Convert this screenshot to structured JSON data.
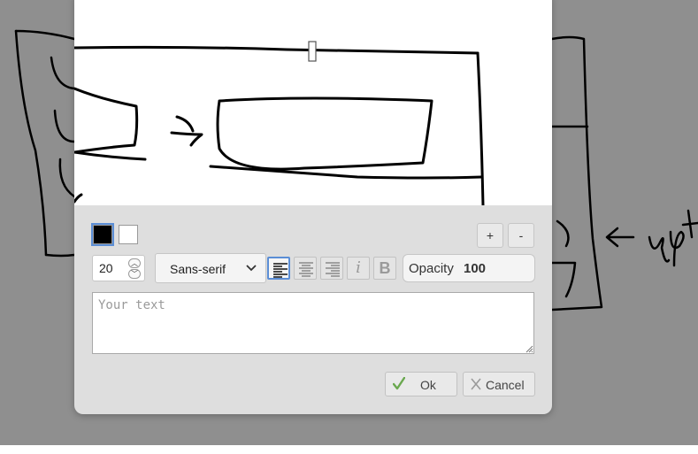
{
  "colors": {
    "accent": "#5b8ed6",
    "ok_check": "#6aa84f",
    "foreground": "#000000",
    "background": "#ffffff"
  },
  "background_sketch": {
    "annotation_text": "op"
  },
  "toolbar": {
    "zoom_in_label": "+",
    "zoom_out_label": "-",
    "font_size": "20",
    "font_family": "Sans-serif",
    "italic_glyph": "i",
    "bold_glyph": "B",
    "opacity_label": "Opacity",
    "opacity_value": "100"
  },
  "text_input": {
    "placeholder": "Your text",
    "value": ""
  },
  "actions": {
    "ok_label": "Ok",
    "cancel_label": "Cancel"
  },
  "icons": [
    "check-icon",
    "x-icon",
    "chevron-down-icon",
    "align-left-icon",
    "align-center-icon",
    "align-right-icon",
    "italic-icon",
    "bold-icon",
    "spin-up-icon",
    "spin-down-icon",
    "resize-grip-icon",
    "text-cursor-icon"
  ]
}
